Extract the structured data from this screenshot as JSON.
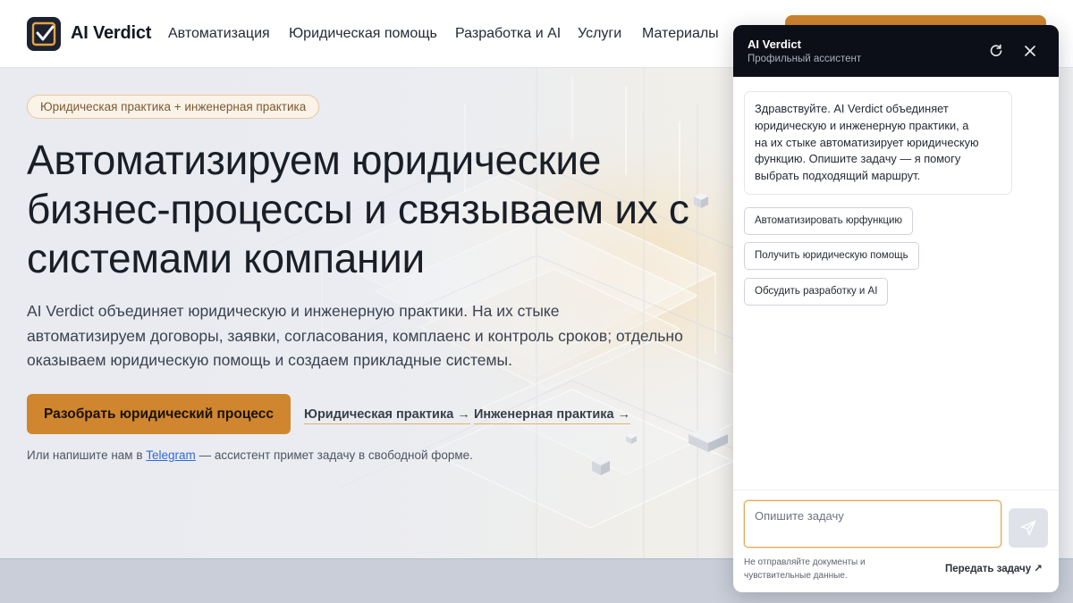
{
  "header": {
    "brand": "AI Verdict",
    "nav": [
      {
        "label": "Автоматизация"
      },
      {
        "label": "Юридическая помощь"
      },
      {
        "label": "Разработка и AI"
      },
      {
        "label": "Услуги"
      },
      {
        "label": "Материалы"
      }
    ],
    "logo_icon": "checkmark-shield-icon"
  },
  "hero": {
    "pill": "Юридическая практика + инженерная практика",
    "headline": [
      "Автоматизируем юридические",
      "бизнес-процессы и связываем их с",
      "системами компании"
    ],
    "lead": [
      "AI Verdict объединяет юридическую и инженерную практики. На их стыке",
      "автоматизируем договоры, заявки, согласования, комплаенс и контроль сроков; отдельно",
      "оказываем юридическую помощь и создаем прикладные системы."
    ],
    "primary_button": "Разобрать юридический процесс",
    "link_legal": "Юридическая практика →",
    "link_engineering": "Инженерная практика →",
    "footnote_prefix": "Или напишите нам в ",
    "footnote_link": "Telegram",
    "footnote_suffix": " — ассистент примет задачу в свободной форме."
  },
  "chat": {
    "title": "AI Verdict",
    "subtitle": "Профильный ассистент",
    "message": [
      "Здравствуйте. AI Verdict объединяет",
      "юридическую и инженерную практики, а",
      "на их стыке автоматизирует юридическую",
      "функцию. Опишите задачу — я помогу",
      "выбрать подходящий маршрут."
    ],
    "quick_replies": [
      "Автоматизировать юрфункцию",
      "Получить юридическую помощь",
      "Обсудить разработку и AI"
    ],
    "input_placeholder": "Опишите задачу",
    "disclaimer": [
      "Не отправляйте документы и",
      "чувствительные данные."
    ],
    "handoff": "Передать задачу ↗"
  },
  "colors": {
    "accent": "#d0852f",
    "chat_header": "#0c0f17",
    "link": "#2f6bd8"
  }
}
